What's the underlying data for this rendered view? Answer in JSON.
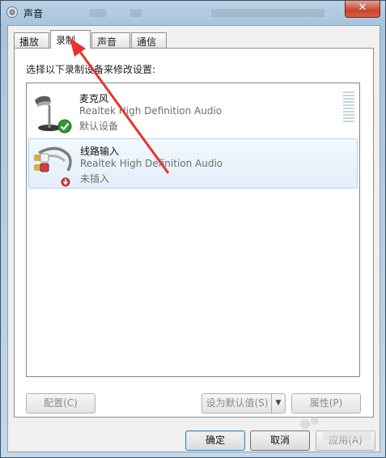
{
  "window": {
    "title": "声音",
    "close_label": "✕"
  },
  "tabs": [
    {
      "label": "播放"
    },
    {
      "label": "录制"
    },
    {
      "label": "声音"
    },
    {
      "label": "通信"
    }
  ],
  "panel": {
    "instruction": "选择以下录制设备来修改设置:"
  },
  "devices": [
    {
      "name": "麦克风",
      "description": "Realtek High Definition Audio",
      "status": "默认设备",
      "icon": "microphone-icon",
      "badge": "default-check-icon"
    },
    {
      "name": "线路输入",
      "description": "Realtek High Definition Audio",
      "status": "未插入",
      "icon": "line-in-cable-icon",
      "badge": "unplugged-icon"
    }
  ],
  "buttons": {
    "configure": "配置(C)",
    "set_default": "设为默认值(S)",
    "properties": "属性(P)",
    "ok": "确定",
    "cancel": "取消",
    "apply": "应用(A)"
  },
  "colors": {
    "title_bar": "#b9d1e6",
    "close_button": "#c9452c",
    "selection": "#e2eefa",
    "annotation_arrow": "#e8342c"
  }
}
